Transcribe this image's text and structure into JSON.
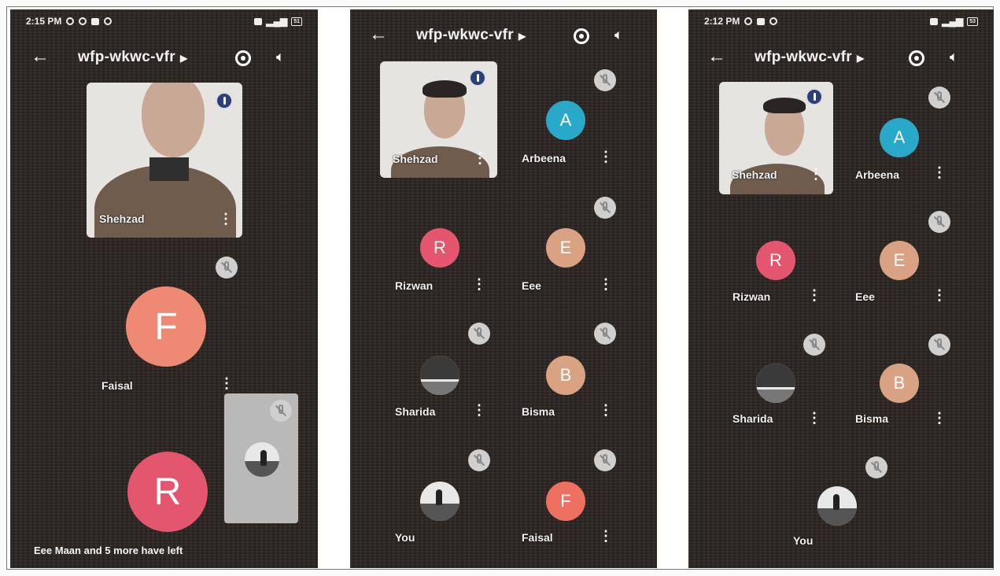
{
  "phones": [
    {
      "time": "2:15 PM",
      "battery": "51",
      "title": "wfp-wkwc-vfr",
      "tile_name": "Shehzad",
      "participants": [
        {
          "name": "Faisal",
          "initial": "F",
          "color": "#ee8a74"
        },
        {
          "name": "",
          "initial": "R",
          "color": "#e4566d"
        }
      ],
      "toast": "Eee Maan and 5 more have left"
    },
    {
      "title": "wfp-wkwc-vfr",
      "tile_name": "Shehzad",
      "participants": [
        {
          "name": "Arbeena",
          "initial": "A",
          "color": "#29a8c9"
        },
        {
          "name": "Rizwan",
          "initial": "R",
          "color": "#e4566d"
        },
        {
          "name": "Eee",
          "initial": "E",
          "color": "#d9a383"
        },
        {
          "name": "Sharida",
          "initial": "",
          "color": ""
        },
        {
          "name": "Bisma",
          "initial": "B",
          "color": "#d9a383"
        },
        {
          "name": "You",
          "initial": "",
          "color": ""
        },
        {
          "name": "Faisal",
          "initial": "F",
          "color": "#ee7060"
        }
      ]
    },
    {
      "time": "2:12 PM",
      "battery": "53",
      "title": "wfp-wkwc-vfr",
      "tile_name": "Shehzad",
      "participants": [
        {
          "name": "Arbeena",
          "initial": "A",
          "color": "#29a8c9"
        },
        {
          "name": "Rizwan",
          "initial": "R",
          "color": "#e4566d"
        },
        {
          "name": "Eee",
          "initial": "E",
          "color": "#d9a383"
        },
        {
          "name": "Sharida",
          "initial": "",
          "color": ""
        },
        {
          "name": "Bisma",
          "initial": "B",
          "color": "#d9a383"
        },
        {
          "name": "You",
          "initial": "",
          "color": ""
        }
      ]
    }
  ],
  "icons": {
    "back": "arrow-left-icon",
    "switch_camera": "switch-camera-icon",
    "speaker": "speaker-icon",
    "mic_off": "mic-off-icon",
    "more": "more-vert-icon"
  }
}
